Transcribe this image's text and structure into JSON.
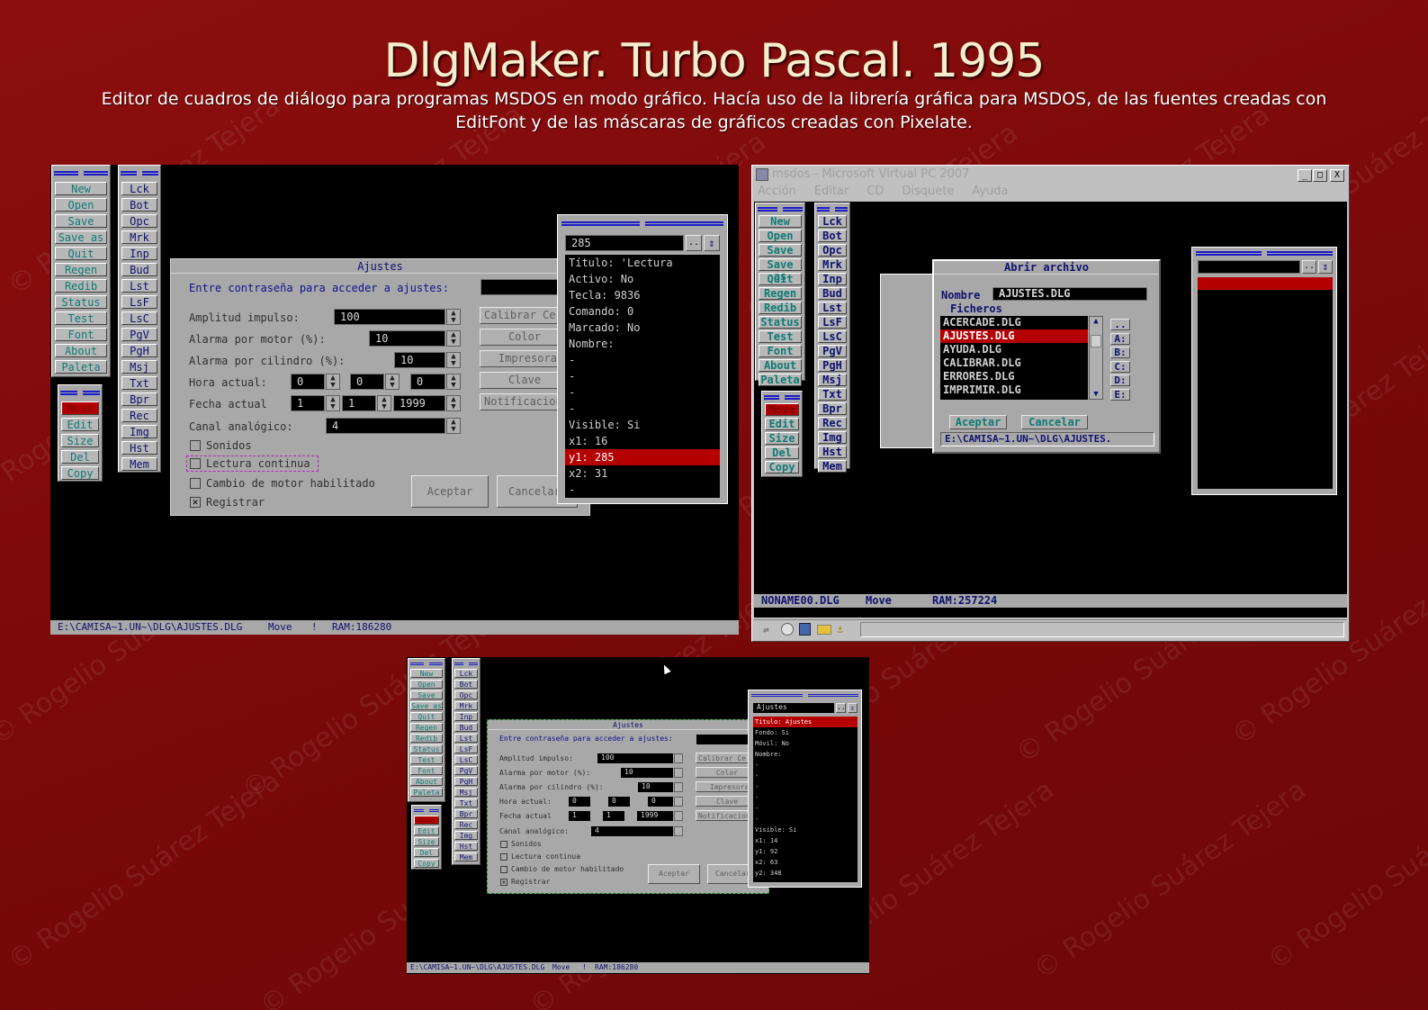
{
  "title": "DlgMaker. Turbo Pascal. 1995",
  "subtitle": "Editor de cuadros de diálogo para programas MSDOS en modo gráfico. Hacía uso de la librería gráfica para MSDOS, de las fuentes creadas con EditFont y de las máscaras de gráficos creadas con Pixelate.",
  "watermark": "© Rogelio Suárez Tejera",
  "colors": {
    "background": "#7e0a0a",
    "accent": "#b40000",
    "palette_bg": "#a8a8a8",
    "button_text": "#0f7b76"
  },
  "tools": [
    "New",
    "Open",
    "Save",
    "Save as",
    "Quit",
    "Regen",
    "Redib",
    "Status",
    "Test",
    "Font",
    "About",
    "Paleta"
  ],
  "edit_tools": [
    "Move",
    "Edit",
    "Size",
    "Del",
    "Copy"
  ],
  "controls": [
    "Lck",
    "Bot",
    "Opc",
    "Mrk",
    "Inp",
    "Bud",
    "Lst",
    "LsF",
    "LsC",
    "PgV",
    "PgH",
    "Msj",
    "Txt",
    "Bpr",
    "Rec",
    "Img",
    "Hst",
    "Mem"
  ],
  "ajustes": {
    "title": "Ajustes",
    "password_label": "Entre contraseña para acceder a ajustes:",
    "rows": [
      {
        "label": "Amplitud impulso:",
        "value": "100"
      },
      {
        "label": "Alarma por motor (%):",
        "value": "10"
      },
      {
        "label": "Alarma por cilindro (%):",
        "value": "10"
      },
      {
        "label": "Hora actual:",
        "v1": "0",
        "v2": "0",
        "v3": "0"
      },
      {
        "label": "Fecha actual",
        "v1": "1",
        "v2": "1",
        "v3": "1999"
      },
      {
        "label": "Canal analógico:",
        "value": "4"
      }
    ],
    "side_buttons": [
      "Calibrar Ce",
      "Color",
      "Impresoras",
      "Clave",
      "Notificacion"
    ],
    "checks": [
      {
        "label": "Sonidos",
        "checked": false
      },
      {
        "label": "Lectura continua",
        "checked": false
      },
      {
        "label": "Cambio de motor habilitado",
        "checked": false
      },
      {
        "label": "Registrar",
        "checked": true
      }
    ],
    "ok": "Aceptar",
    "cancel": "Cancelar"
  },
  "inspector1": {
    "value": "285",
    "dots": "..",
    "arrow": "⇕",
    "lines": [
      "Título: 'Lectura",
      "Activo: No",
      "Tecla: 9836",
      "Comando: 0",
      "Marcado: No",
      "Nombre:",
      "-",
      "-",
      "-",
      "-",
      "Visible: Si",
      "x1: 16",
      "y1: 285",
      "x2: 31",
      "-"
    ],
    "selected_index": 12
  },
  "status1": {
    "path": "E:\\CAMISA~1.UN~\\DLG\\AJUSTES.DLG",
    "mode": "Move",
    "flag": "!",
    "ram": "RAM:186280"
  },
  "vpc": {
    "title": "msdos - Microsoft Virtual PC 2007",
    "menu": [
      "Acción",
      "Editar",
      "CD",
      "Disquete",
      "Ayuda"
    ],
    "win_buttons": [
      "_",
      "□",
      "X"
    ],
    "status": {
      "file": "NONAME00.DLG",
      "mode": "Move",
      "ram": "RAM:257224"
    },
    "open_dialog": {
      "title": "Abrir archivo",
      "name_label": "Nombre",
      "name_value": "AJUSTES.DLG",
      "files_label": "Ficheros",
      "files": [
        "ACERCADE.DLG",
        "AJUSTES.DLG",
        "AYUDA.DLG",
        "CALIBRAR.DLG",
        "ERRORES.DLG",
        "IMPRIMIR.DLG"
      ],
      "selected_file": 1,
      "drives": [
        "..",
        "A:",
        "B:",
        "C:",
        "D:",
        "E:"
      ],
      "ok": "Aceptar",
      "cancel": "Cancelar",
      "path": "E:\\CAMISA~1.UN~\\DLG\\AJUSTES."
    }
  },
  "inspector3": {
    "value": "Ajustes",
    "lines": [
      "Título: Ajustes",
      "Fondo: Si",
      "Móvil: No",
      "Nombre:",
      "-",
      "-",
      "-",
      "-",
      "-",
      "-",
      "Visible: Si",
      "x1: 14",
      "y1: 92",
      "x2: 63",
      "y2: 348"
    ],
    "selected_index": 0
  },
  "status3": {
    "path": "E:\\CAMISA~1.UN~\\DLG\\AJUSTES.DLG",
    "mode": "Move",
    "flag": "!",
    "ram": "RAM:186280"
  }
}
